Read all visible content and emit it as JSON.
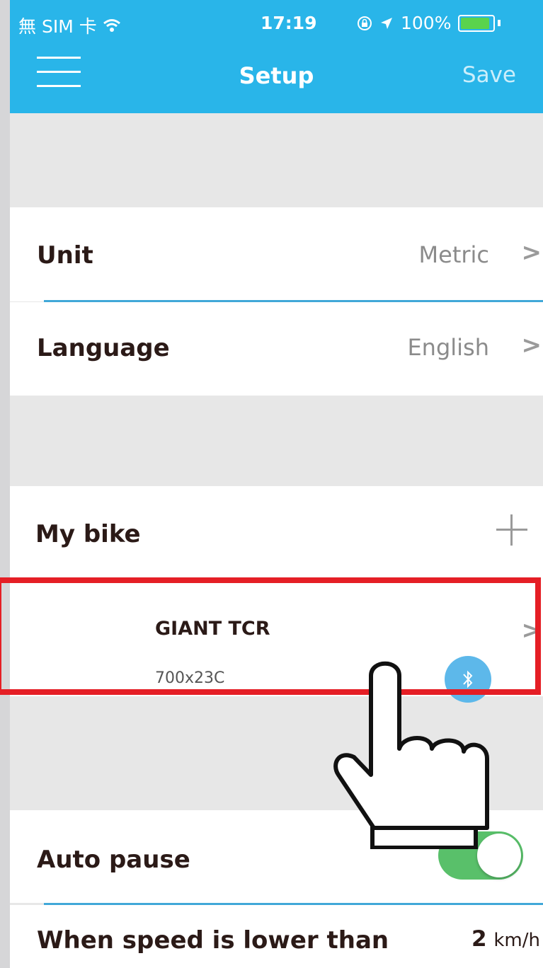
{
  "status_bar": {
    "carrier": "無 SIM 卡",
    "time": "17:19",
    "battery_percent": "100%",
    "battery_level": 1.0
  },
  "nav": {
    "title": "Setup",
    "save_label": "Save"
  },
  "settings": {
    "unit": {
      "label": "Unit",
      "value": "Metric"
    },
    "language": {
      "label": "Language",
      "value": "English"
    }
  },
  "bikes": {
    "header": "My bike",
    "items": [
      {
        "name": "GIANT TCR",
        "wheel_size": "700x23C",
        "bluetooth_connected": true
      }
    ]
  },
  "auto_pause": {
    "label": "Auto pause",
    "enabled": true,
    "threshold_label": "When speed is lower than",
    "threshold_value": "2",
    "threshold_unit": "km/h"
  },
  "colors": {
    "header_blue": "#29b5e9",
    "divider_blue": "#41a8d8",
    "toggle_green": "#59c06a",
    "highlight_red": "#e51e25"
  }
}
